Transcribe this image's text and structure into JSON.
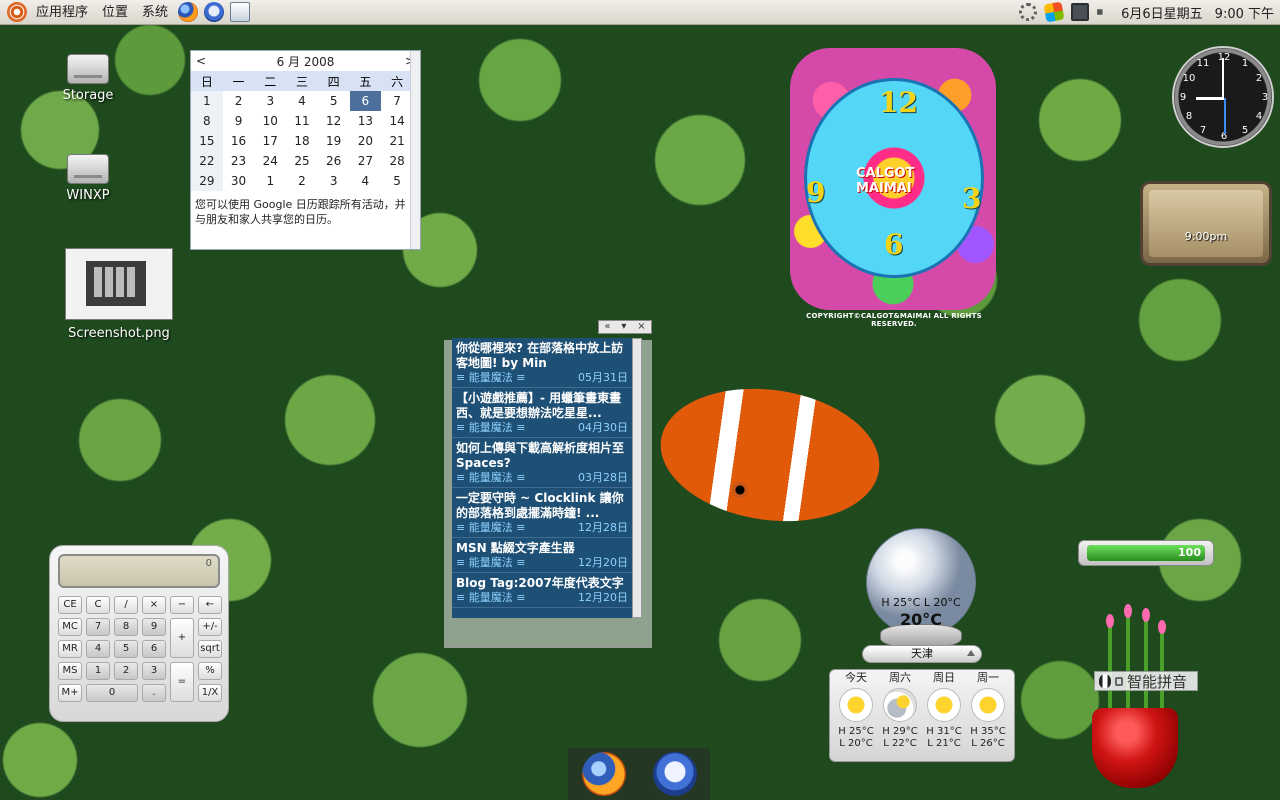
{
  "top_panel": {
    "menus": [
      "应用程序",
      "位置",
      "系统"
    ],
    "date": "6月6日星期五",
    "time": "9:00 下午"
  },
  "desktop_icons": [
    {
      "label": "Storage"
    },
    {
      "label": "WINXP"
    },
    {
      "label": "Screenshot.png"
    }
  ],
  "calendar": {
    "prev": "<",
    "next": ">",
    "title": "6 月 2008",
    "weekdays": [
      "日",
      "一",
      "二",
      "三",
      "四",
      "五",
      "六"
    ],
    "weeks": [
      [
        "1",
        "2",
        "3",
        "4",
        "5",
        "6",
        "7"
      ],
      [
        "8",
        "9",
        "10",
        "11",
        "12",
        "13",
        "14"
      ],
      [
        "15",
        "16",
        "17",
        "18",
        "19",
        "20",
        "21"
      ],
      [
        "22",
        "23",
        "24",
        "25",
        "26",
        "27",
        "28"
      ],
      [
        "29",
        "30",
        "1",
        "2",
        "3",
        "4",
        "5"
      ]
    ],
    "today": "6",
    "note": "您可以使用 Google 日历跟踪所有活动，并与朋友和家人共享您的日历。"
  },
  "rss": {
    "controls": [
      "«",
      "▾",
      "×"
    ],
    "items": [
      {
        "title": "你從哪裡來? 在部落格中放上訪客地圖! by Min",
        "source": "≡ 能量魔法 ≡",
        "date": "05月31日"
      },
      {
        "title": "【小遊戲推薦】- 用蠟筆畫東畫西、就是要想辦法吃星星...",
        "source": "≡ 能量魔法 ≡",
        "date": "04月30日"
      },
      {
        "title": "如何上傳與下載高解析度相片至Spaces?",
        "source": "≡ 能量魔法 ≡",
        "date": "03月28日"
      },
      {
        "title": "一定要守時 ~ Clocklink 讓你的部落格到處擺滿時鐘! ...",
        "source": "≡ 能量魔法 ≡",
        "date": "12月28日"
      },
      {
        "title": "MSN 點綴文字產生器",
        "source": "≡ 能量魔法 ≡",
        "date": "12月20日"
      },
      {
        "title": "Blog Tag:2007年度代表文字",
        "source": "≡ 能量魔法 ≡",
        "date": "12月20日"
      }
    ]
  },
  "flower_clock": {
    "numbers": [
      "12",
      "3",
      "6",
      "9"
    ],
    "brand_line1": "CALGOT",
    "brand_line2": "MAIMAI",
    "copyright": "COPYRIGHT©CALGOT&MAIMAI ALL RIGHTS RESERVED."
  },
  "analog_clock": {
    "numbers": [
      "12",
      "1",
      "2",
      "3",
      "4",
      "5",
      "6",
      "7",
      "8",
      "9",
      "10",
      "11"
    ]
  },
  "world_clock": {
    "time": "9:00pm"
  },
  "battery": {
    "value": "100",
    "level_percent": 100
  },
  "calculator": {
    "display": "0",
    "buttons": [
      "CE",
      "C",
      "/",
      "×",
      "−",
      "←",
      "MC",
      "7",
      "8",
      "9",
      "+",
      "+/-",
      "MR",
      "4",
      "5",
      "6",
      "sqrt",
      "MS",
      "1",
      "2",
      "3",
      "=",
      "%",
      "M+",
      "0",
      ".",
      "1/X"
    ]
  },
  "weather": {
    "current_hl": "H 25°C L 20°C",
    "current_temp": "20°C",
    "city": "天津",
    "forecast": [
      {
        "day": "今天",
        "high": "H 25°C",
        "low": "L 20°C",
        "icon": "sunny-icon"
      },
      {
        "day": "周六",
        "high": "H 29°C",
        "low": "L 22°C",
        "icon": "partly-cloudy-icon"
      },
      {
        "day": "周日",
        "high": "H 31°C",
        "low": "L 21°C",
        "icon": "sunny-icon"
      },
      {
        "day": "周一",
        "high": "H 35°C",
        "low": "L 26°C",
        "icon": "sunny-icon"
      }
    ]
  },
  "ime": {
    "label": "智能拼音"
  },
  "dock": {
    "items": [
      "firefox-icon",
      "thunderbird-icon"
    ]
  }
}
